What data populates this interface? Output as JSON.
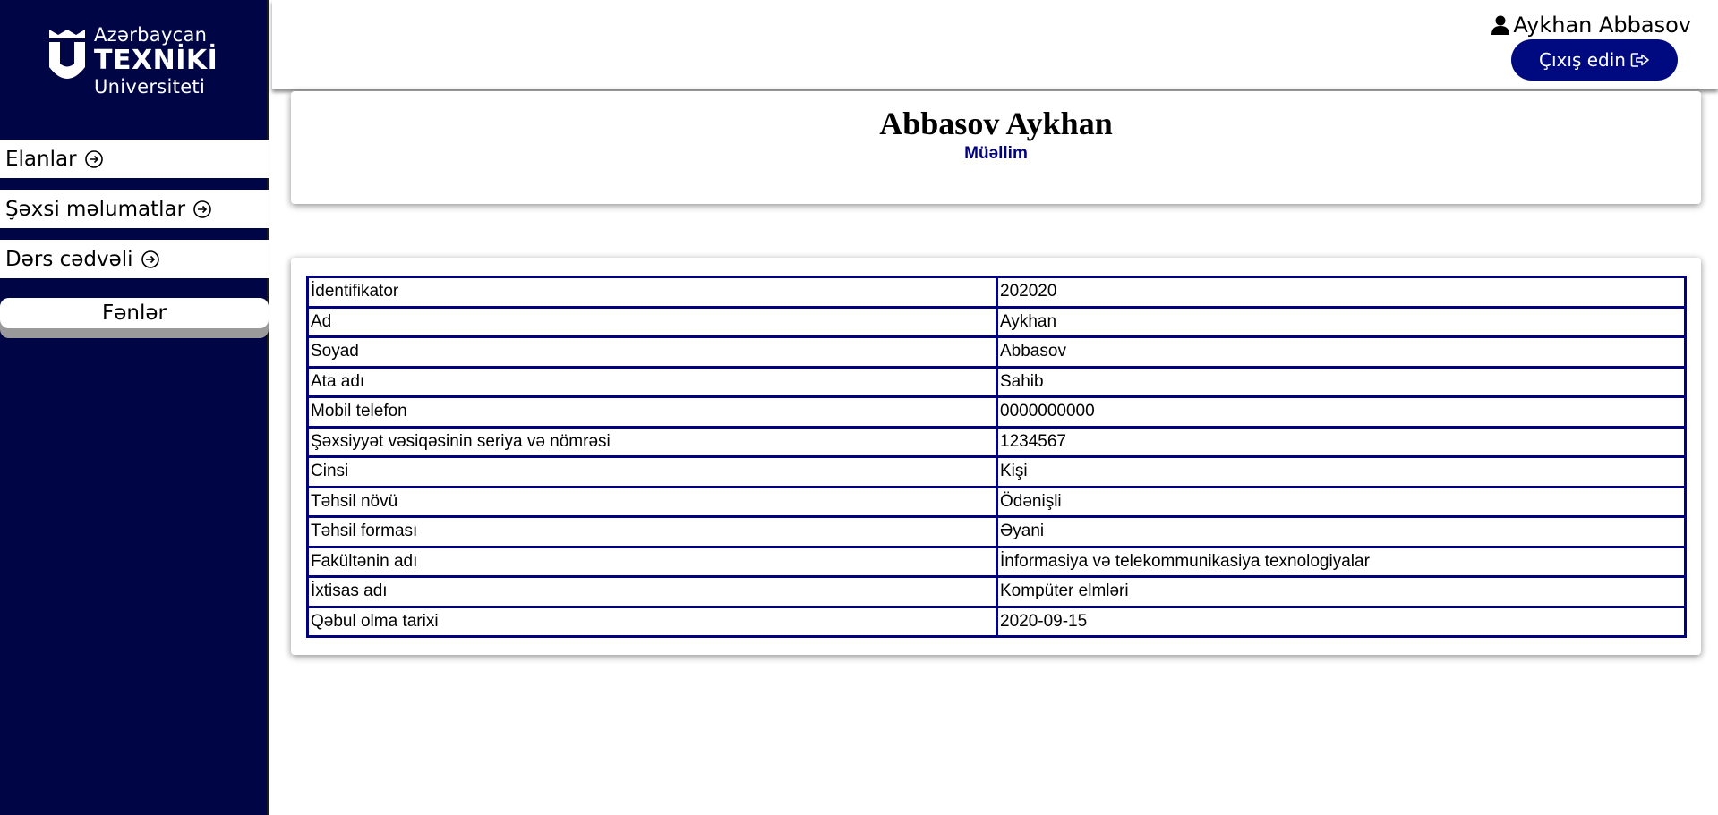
{
  "logo": {
    "line1": "Azərbaycan",
    "line2": "TEXNİKİ",
    "line3": "Universiteti"
  },
  "sidebar": {
    "items": [
      {
        "label": "Elanlar",
        "icon": "circle-arrow-right-icon"
      },
      {
        "label": "Şəxsi məlumatlar",
        "icon": "circle-arrow-right-icon"
      },
      {
        "label": "Dərs cədvəli",
        "icon": "circle-arrow-right-icon"
      }
    ],
    "button_label": "Fənlər"
  },
  "header": {
    "user_name": "Aykhan Abbasov",
    "user_icon": "user-icon",
    "logout_label": "Çıxış edin",
    "logout_icon": "sign-out-icon"
  },
  "profile": {
    "full_name": "Abbasov Aykhan",
    "role": "Müəllim"
  },
  "info_table": {
    "rows": [
      {
        "key": "İdentifikator",
        "value": "202020"
      },
      {
        "key": "Ad",
        "value": "Aykhan"
      },
      {
        "key": "Soyad",
        "value": "Abbasov"
      },
      {
        "key": "Ata adı",
        "value": "Sahib"
      },
      {
        "key": "Mobil telefon",
        "value": "0000000000"
      },
      {
        "key": "Şəxsiyyət vəsiqəsinin seriya və nömrəsi",
        "value": "1234567"
      },
      {
        "key": "Cinsi",
        "value": "Kişi"
      },
      {
        "key": "Təhsil növü",
        "value": "Ödənişli"
      },
      {
        "key": "Təhsil forması",
        "value": "Əyani"
      },
      {
        "key": "Fakültənin adı",
        "value": "İnformasiya və telekommunikasiya texnologiyalar"
      },
      {
        "key": "İxtisas adı",
        "value": "Kompüter elmləri"
      },
      {
        "key": "Qəbul olma tarixi",
        "value": "2020-09-15"
      }
    ]
  },
  "colors": {
    "sidebar_bg": "#000545",
    "accent": "#000a80",
    "table_border": "#000080"
  }
}
